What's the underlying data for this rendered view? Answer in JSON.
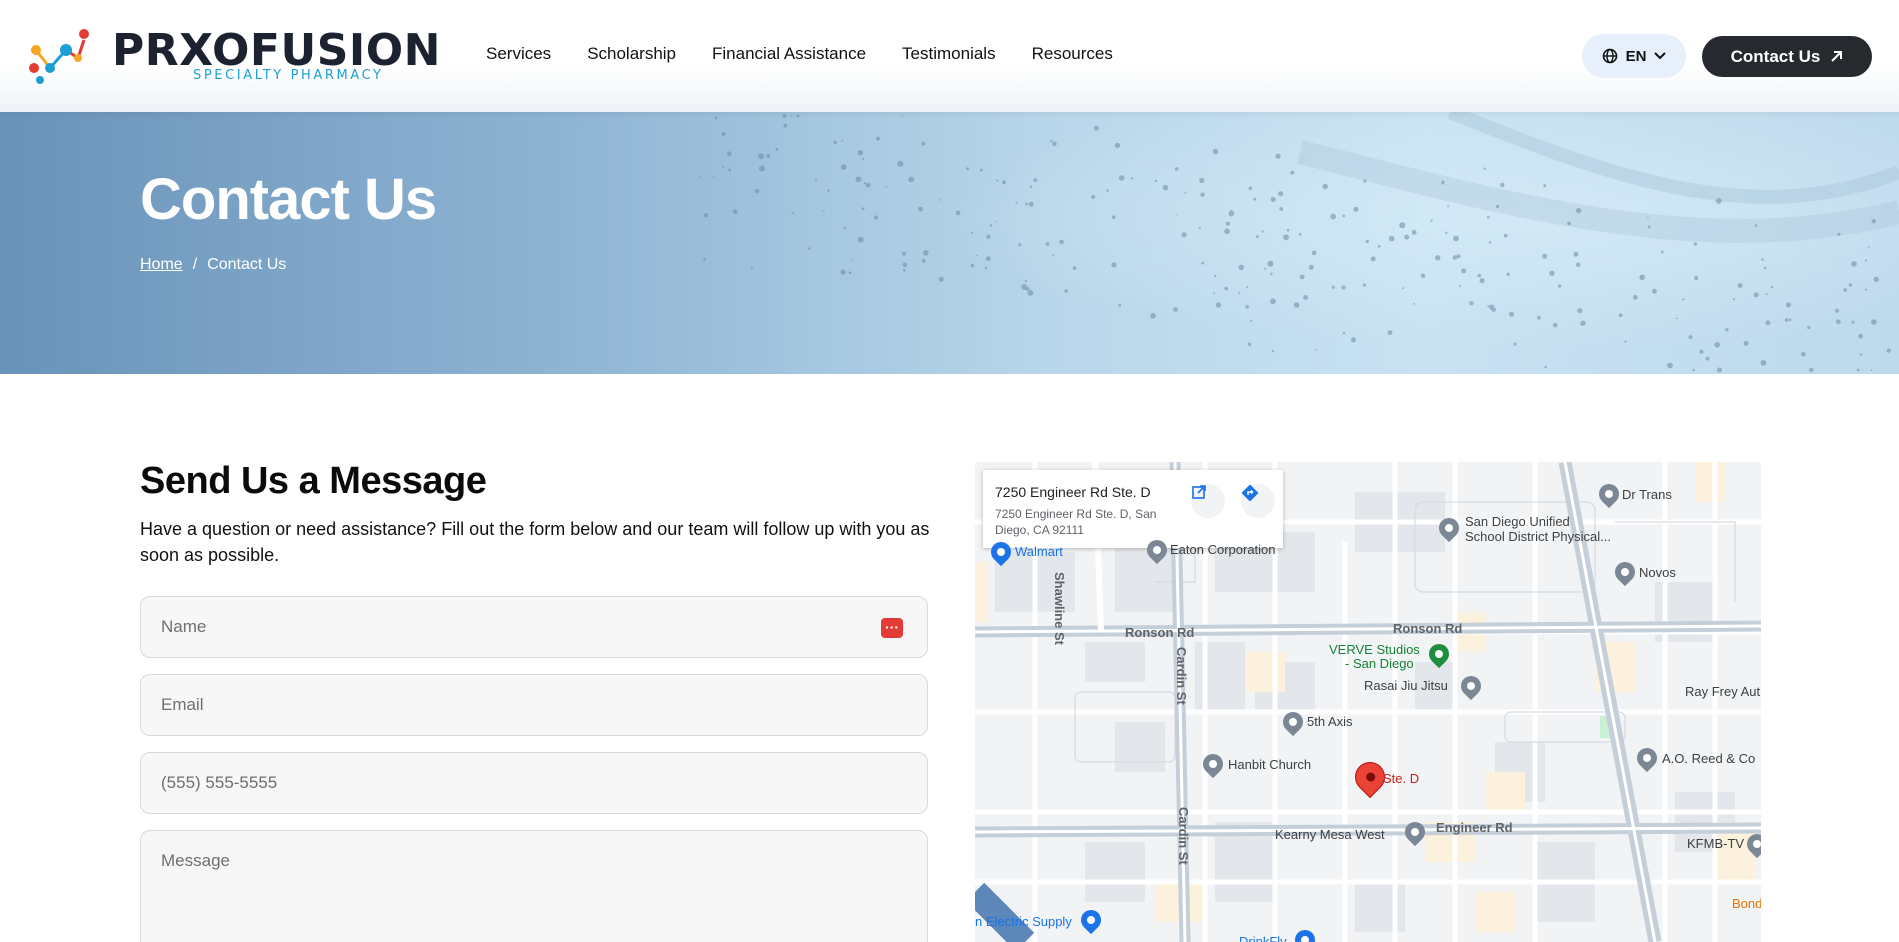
{
  "header": {
    "logo": {
      "name_part1": "PR",
      "name_x": "X",
      "name_part2": "OFUSION",
      "tagline": "SPECIALTY PHARMACY"
    },
    "nav": [
      {
        "label": "Services"
      },
      {
        "label": "Scholarship"
      },
      {
        "label": "Financial Assistance"
      },
      {
        "label": "Testimonials"
      },
      {
        "label": "Resources"
      }
    ],
    "language": {
      "label": "EN",
      "icon": "globe-icon"
    },
    "cta": {
      "label": "Contact Us",
      "icon": "arrow-up-right-icon"
    }
  },
  "hero": {
    "title": "Contact Us",
    "breadcrumb": {
      "home": "Home",
      "separator": "/",
      "current": "Contact Us"
    }
  },
  "form": {
    "title": "Send Us a Message",
    "description": "Have a question or need assistance? Fill out the form below and our team will follow up with you as soon as possible.",
    "fields": {
      "name": {
        "placeholder": "Name",
        "value": ""
      },
      "email": {
        "placeholder": "Email",
        "value": ""
      },
      "phone": {
        "placeholder": "(555) 555-5555",
        "value": ""
      },
      "message": {
        "placeholder": "Message",
        "value": ""
      }
    },
    "autofill_icon": "password-manager-icon"
  },
  "map": {
    "card": {
      "title": "7250 Engineer Rd Ste. D",
      "address": "7250 Engineer Rd Ste. D, San Diego, CA 92111",
      "open_icon": "open-external-icon",
      "directions_icon": "directions-icon"
    },
    "labels": {
      "walmart": "Walmart",
      "eaton": "Eaton Corporation",
      "dr_trans": "Dr Trans",
      "sdusd": "San Diego Unified",
      "sdusd2": "School District Physical...",
      "novos": "Novos",
      "shawline": "Shawline St",
      "ronson_left": "Ronson Rd",
      "ronson_right": "Ronson Rd",
      "verve": "VERVE Studios",
      "verve2": "- San Diego",
      "rasai": "Rasai Jiu Jitsu",
      "cardin_top": "Cardin St",
      "ray_frey": "Ray Frey Aut",
      "fifth_axis": "5th Axis",
      "hanbit": "Hanbit Church",
      "ste_d": "Ste. D",
      "ao_reed": "A.O. Reed & Co",
      "kearny": "Kearny Mesa West",
      "engineer": "Engineer Rd",
      "kfmb": "KFMB-TV",
      "cardin_bottom": "Cardin St",
      "bond": "Bond",
      "electric": "n Electric Supply",
      "drinkfly": "DrinkFly"
    }
  }
}
